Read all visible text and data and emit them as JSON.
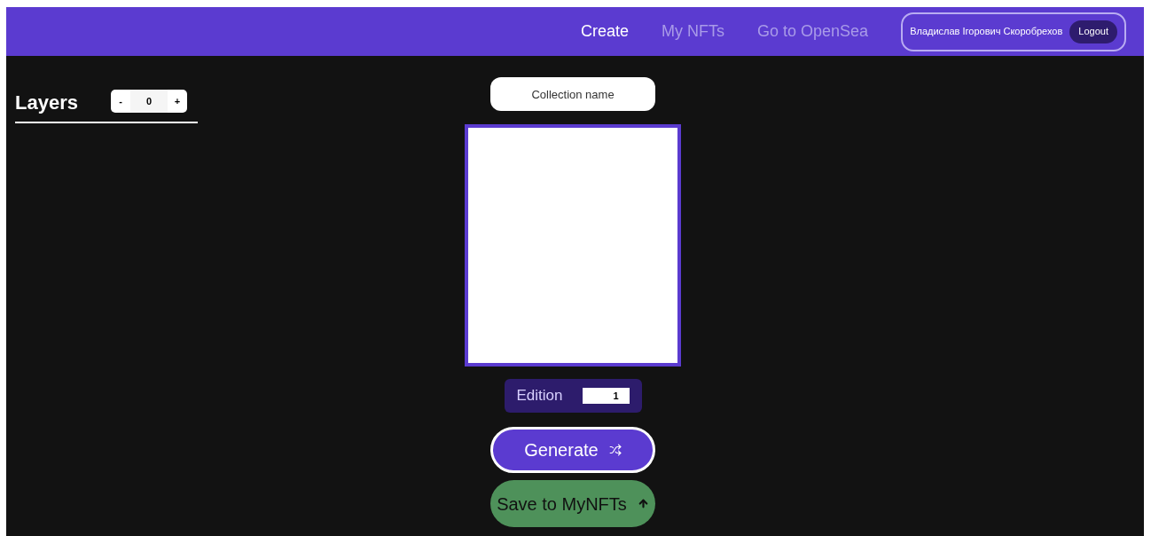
{
  "nav": [
    {
      "label": "Create",
      "selected": true
    },
    {
      "label": "My NFTs",
      "selected": false
    },
    {
      "label": "Go to OpenSea",
      "selected": false
    }
  ],
  "user": {
    "name": "Владислав Ігорович Скоробрехов",
    "logout": "Logout"
  },
  "layers": {
    "title": "Layers",
    "minus": "-",
    "count": "0",
    "plus": "+"
  },
  "collection": {
    "placeholder": "Collection name"
  },
  "edition": {
    "label": "Edition",
    "value": "1"
  },
  "buttons": {
    "generate": "Generate",
    "save": "Save to MyNFTs"
  }
}
